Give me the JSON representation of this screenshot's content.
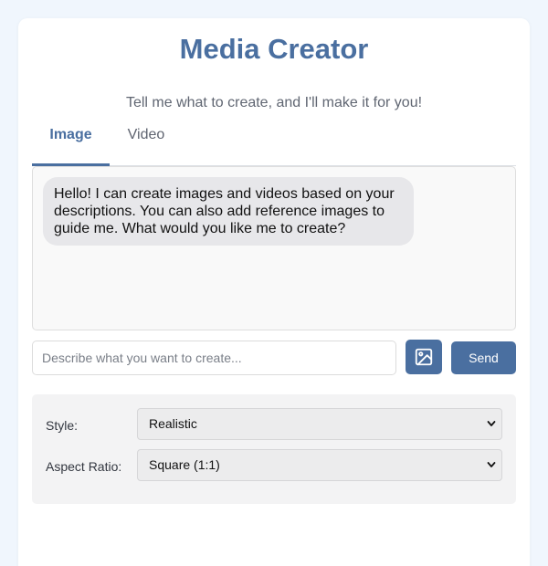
{
  "header": {
    "title": "Media Creator",
    "subtitle": "Tell me what to create, and I'll make it for you!"
  },
  "tabs": [
    {
      "label": "Image",
      "active": true
    },
    {
      "label": "Video",
      "active": false
    }
  ],
  "chat": {
    "messages": [
      {
        "role": "assistant",
        "text": "Hello! I can create images and videos based on your descriptions. You can also add reference images to guide me. What would you like me to create?"
      }
    ]
  },
  "composer": {
    "placeholder": "Describe what you want to create...",
    "value": "",
    "image_button_icon": "image-icon",
    "send_label": "Send"
  },
  "options": {
    "style_label": "Style:",
    "style_value": "Realistic",
    "ratio_label": "Aspect Ratio:",
    "ratio_value": "Square (1:1)"
  },
  "colors": {
    "accent": "#4a6fa0",
    "background": "#f0f6fd",
    "bubble": "#e7e7ea"
  }
}
